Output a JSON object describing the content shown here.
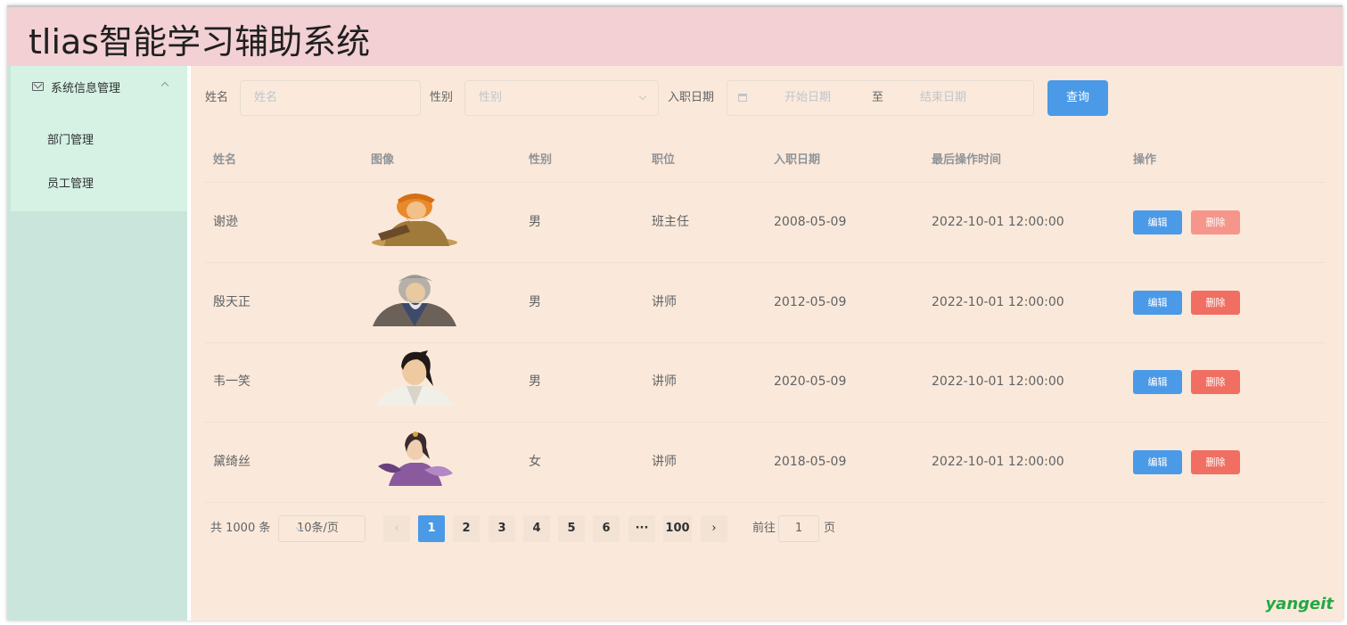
{
  "header": {
    "title": "tlias智能学习辅助系统"
  },
  "sidebar": {
    "group_label": "系统信息管理",
    "items": [
      {
        "label": "部门管理"
      },
      {
        "label": "员工管理"
      }
    ]
  },
  "search": {
    "name_label": "姓名",
    "name_placeholder": "姓名",
    "gender_label": "性别",
    "gender_placeholder": "性别",
    "date_label": "入职日期",
    "start_placeholder": "开始日期",
    "range_sep": "至",
    "end_placeholder": "结束日期",
    "query_button": "查询"
  },
  "table": {
    "columns": [
      "姓名",
      "图像",
      "性别",
      "职位",
      "入职日期",
      "最后操作时间",
      "操作"
    ],
    "rows": [
      {
        "name": "谢逊",
        "gender": "男",
        "job": "班主任",
        "entry": "2008-05-09",
        "update": "2022-10-01 12:00:00"
      },
      {
        "name": "殷天正",
        "gender": "男",
        "job": "讲师",
        "entry": "2012-05-09",
        "update": "2022-10-01 12:00:00"
      },
      {
        "name": "韦一笑",
        "gender": "男",
        "job": "讲师",
        "entry": "2020-05-09",
        "update": "2022-10-01 12:00:00"
      },
      {
        "name": "黛绮丝",
        "gender": "女",
        "job": "讲师",
        "entry": "2018-05-09",
        "update": "2022-10-01 12:00:00"
      }
    ],
    "edit_label": "编辑",
    "delete_label": "删除"
  },
  "pagination": {
    "total_text": "共 1000 条",
    "page_size": "10条/页",
    "pages": [
      "1",
      "2",
      "3",
      "4",
      "5",
      "6",
      "···",
      "100"
    ],
    "current": "1",
    "goto_prefix": "前往",
    "goto_value": "1",
    "goto_suffix": "页"
  },
  "watermark": "yangeit",
  "colors": {
    "header_bg": "#f2d0d4",
    "sidebar_bg": "#cae6dc",
    "main_bg": "#fae9da",
    "primary": "#4a9ae8",
    "danger": "#f06f62"
  }
}
